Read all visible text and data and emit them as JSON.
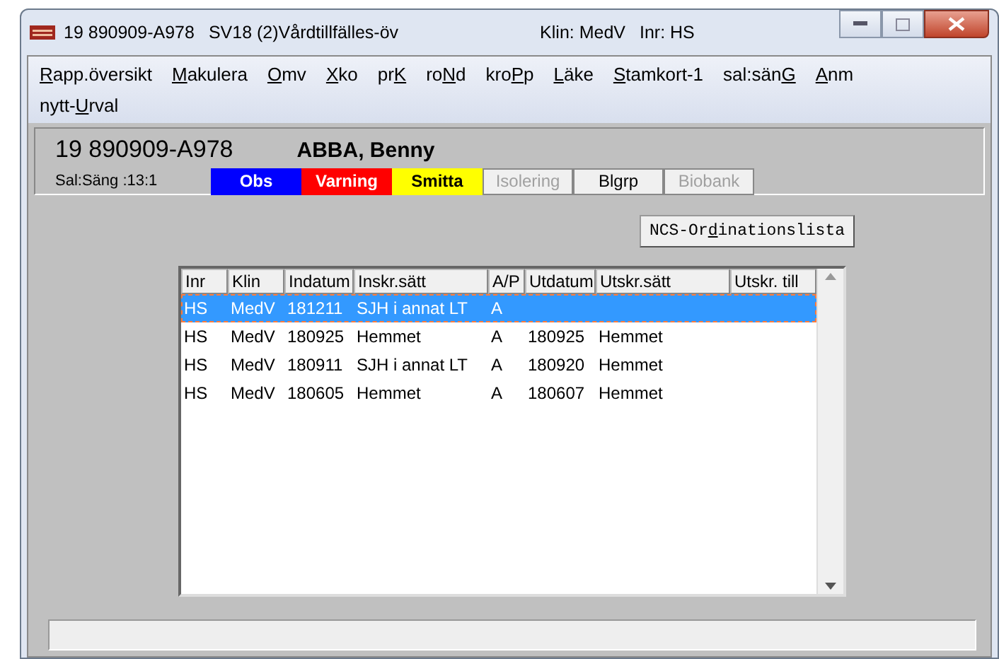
{
  "window": {
    "title_parts": [
      "19 890909-A978",
      "SV18 (2)Vårdtillfälles-öv",
      "Klin: MedV",
      "Inr: HS"
    ]
  },
  "menu": [
    {
      "key": "R",
      "after": "app.översikt"
    },
    {
      "key": "M",
      "after": "akulera"
    },
    {
      "key": "O",
      "after": "mv"
    },
    {
      "key": "X",
      "after": "ko"
    },
    {
      "before": "pr",
      "key": "K"
    },
    {
      "before": "ro",
      "key": "N",
      "after": "d"
    },
    {
      "before": "kro",
      "key": "P",
      "after": "p"
    },
    {
      "key": "L",
      "after": "äke"
    },
    {
      "key": "S",
      "after": "tamkort-1"
    },
    {
      "before": "sal:sän",
      "key": "G"
    },
    {
      "key": "A",
      "after": "nm"
    },
    {
      "before": "nytt-",
      "key": "U",
      "after": "rval"
    }
  ],
  "patient": {
    "id": "19 890909-A978",
    "name": "ABBA, Benny",
    "bed": "Sal:Säng :13:1"
  },
  "flags": [
    {
      "label": "Obs",
      "kind": "colored",
      "color": "#0000ff"
    },
    {
      "label": "Varning",
      "kind": "colored",
      "color": "#ff0000"
    },
    {
      "label": "Smitta",
      "kind": "colored",
      "color": "#ffff00"
    },
    {
      "label": "Isolering",
      "kind": "button",
      "disabled": true
    },
    {
      "label": "Blgrp",
      "kind": "button",
      "disabled": false
    },
    {
      "label": "Biobank",
      "kind": "button",
      "disabled": true
    }
  ],
  "ncs_button": {
    "before": "NCS-Or",
    "key": "d",
    "after": "inationslista"
  },
  "table": {
    "columns": [
      "Inr",
      "Klin",
      "Indatum",
      "Inskr.sätt",
      "A/P",
      "Utdatum",
      "Utskr.sätt",
      "Utskr. till"
    ],
    "rows": [
      {
        "cells": [
          "HS",
          "MedV",
          "181211",
          "SJH i annat LT",
          "A",
          "",
          ""
        ],
        "selected": true
      },
      {
        "cells": [
          "HS",
          "MedV",
          "180925",
          "Hemmet",
          "A",
          "180925",
          "Hemmet"
        ],
        "selected": false
      },
      {
        "cells": [
          "HS",
          "MedV",
          "180911",
          "SJH i annat LT",
          "A",
          "180920",
          "Hemmet"
        ],
        "selected": false
      },
      {
        "cells": [
          "HS",
          "MedV",
          "180605",
          "Hemmet",
          "A",
          "180607",
          "Hemmet"
        ],
        "selected": false
      }
    ]
  }
}
